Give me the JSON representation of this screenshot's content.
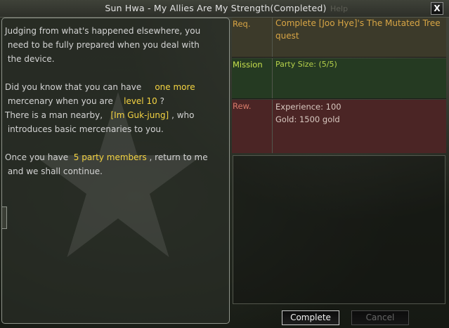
{
  "window": {
    "title": "Sun Hwa - My Allies Are My Strength(Completed)",
    "faint_background_text": "Help",
    "close_label": "X"
  },
  "dialogue": {
    "line1": "Judging from what's happened elsewhere, you",
    "line2": " need to be fully prepared when you deal with",
    "line3": " the device.",
    "line4_a": "Did you know that you can have ",
    "line4_hl": "one more",
    "line5_a": " mercenary when you are ",
    "line5_hl": "level 10",
    "line5_b": "?",
    "line6_a": "There is a man nearby, ",
    "line6_hl": "[Im Guk-jung]",
    "line6_b": ", who",
    "line7": " introduces basic mercenaries to you.",
    "line8_a": "Once you have ",
    "line8_hl": "5 party members",
    "line8_b": ", return to me",
    "line9": " and we shall continue."
  },
  "quest_info": {
    "req": {
      "label": "Req.",
      "line1": "Complete [Joo Hye]'s The Mutated Tree",
      "line2": " quest"
    },
    "mission": {
      "label": "Mission",
      "value": "Party Size: (5/5)"
    },
    "rew": {
      "label": "Rew.",
      "experience": "Experience: 100",
      "gold": "Gold: 1500 gold"
    }
  },
  "buttons": {
    "complete": "Complete",
    "cancel": "Cancel"
  },
  "colors": {
    "highlight": "#f5d442",
    "req_row": "#3c3a2a",
    "mission_row": "#253a22",
    "reward_row": "#4b2525"
  }
}
